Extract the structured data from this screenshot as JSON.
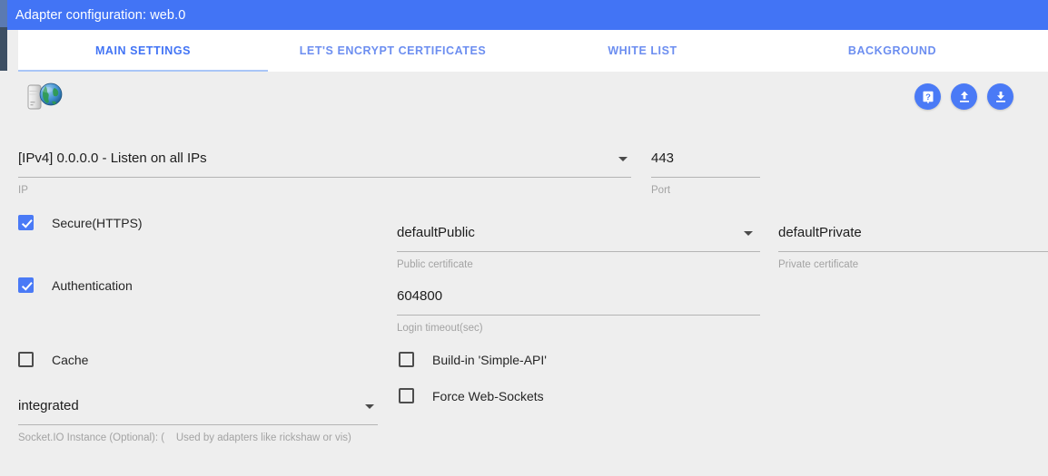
{
  "window": {
    "title": "Adapter configuration: web.0",
    "title_bar_color": "#4274f5"
  },
  "tabs": [
    {
      "label": "MAIN SETTINGS",
      "active": true
    },
    {
      "label": "LET'S ENCRYPT CERTIFICATES",
      "active": false
    },
    {
      "label": "WHITE LIST",
      "active": false
    },
    {
      "label": "BACKGROUND",
      "active": false
    }
  ],
  "toolbar": {
    "logo_icon": "server-globe-icon",
    "buttons": [
      {
        "name": "help-button",
        "icon": "book-question-icon",
        "label": "?"
      },
      {
        "name": "upload-button",
        "icon": "upload-icon",
        "label": ""
      },
      {
        "name": "download-button",
        "icon": "download-icon",
        "label": ""
      }
    ],
    "accent_color": "#4a7af6"
  },
  "form": {
    "ip": {
      "value": "[IPv4] 0.0.0.0 - Listen on all IPs",
      "hint": "IP"
    },
    "port": {
      "value": "443",
      "hint": "Port"
    },
    "secure_https": {
      "label": "Secure(HTTPS)",
      "checked": true
    },
    "authentication": {
      "label": "Authentication",
      "checked": true
    },
    "cache": {
      "label": "Cache",
      "checked": false
    },
    "public_certificate": {
      "value": "defaultPublic",
      "hint": "Public certificate"
    },
    "private_certificate": {
      "value": "defaultPrivate",
      "hint": "Private certificate"
    },
    "login_timeout": {
      "value": "604800",
      "hint": "Login timeout(sec)"
    },
    "simple_api": {
      "label": "Build-in 'Simple-API'",
      "checked": false
    },
    "force_web_sockets": {
      "label": "Force Web-Sockets",
      "checked": false
    },
    "socketio_instance": {
      "value": "integrated",
      "hint": "Socket.IO Instance (Optional): (    Used by adapters like rickshaw or vis)"
    }
  }
}
